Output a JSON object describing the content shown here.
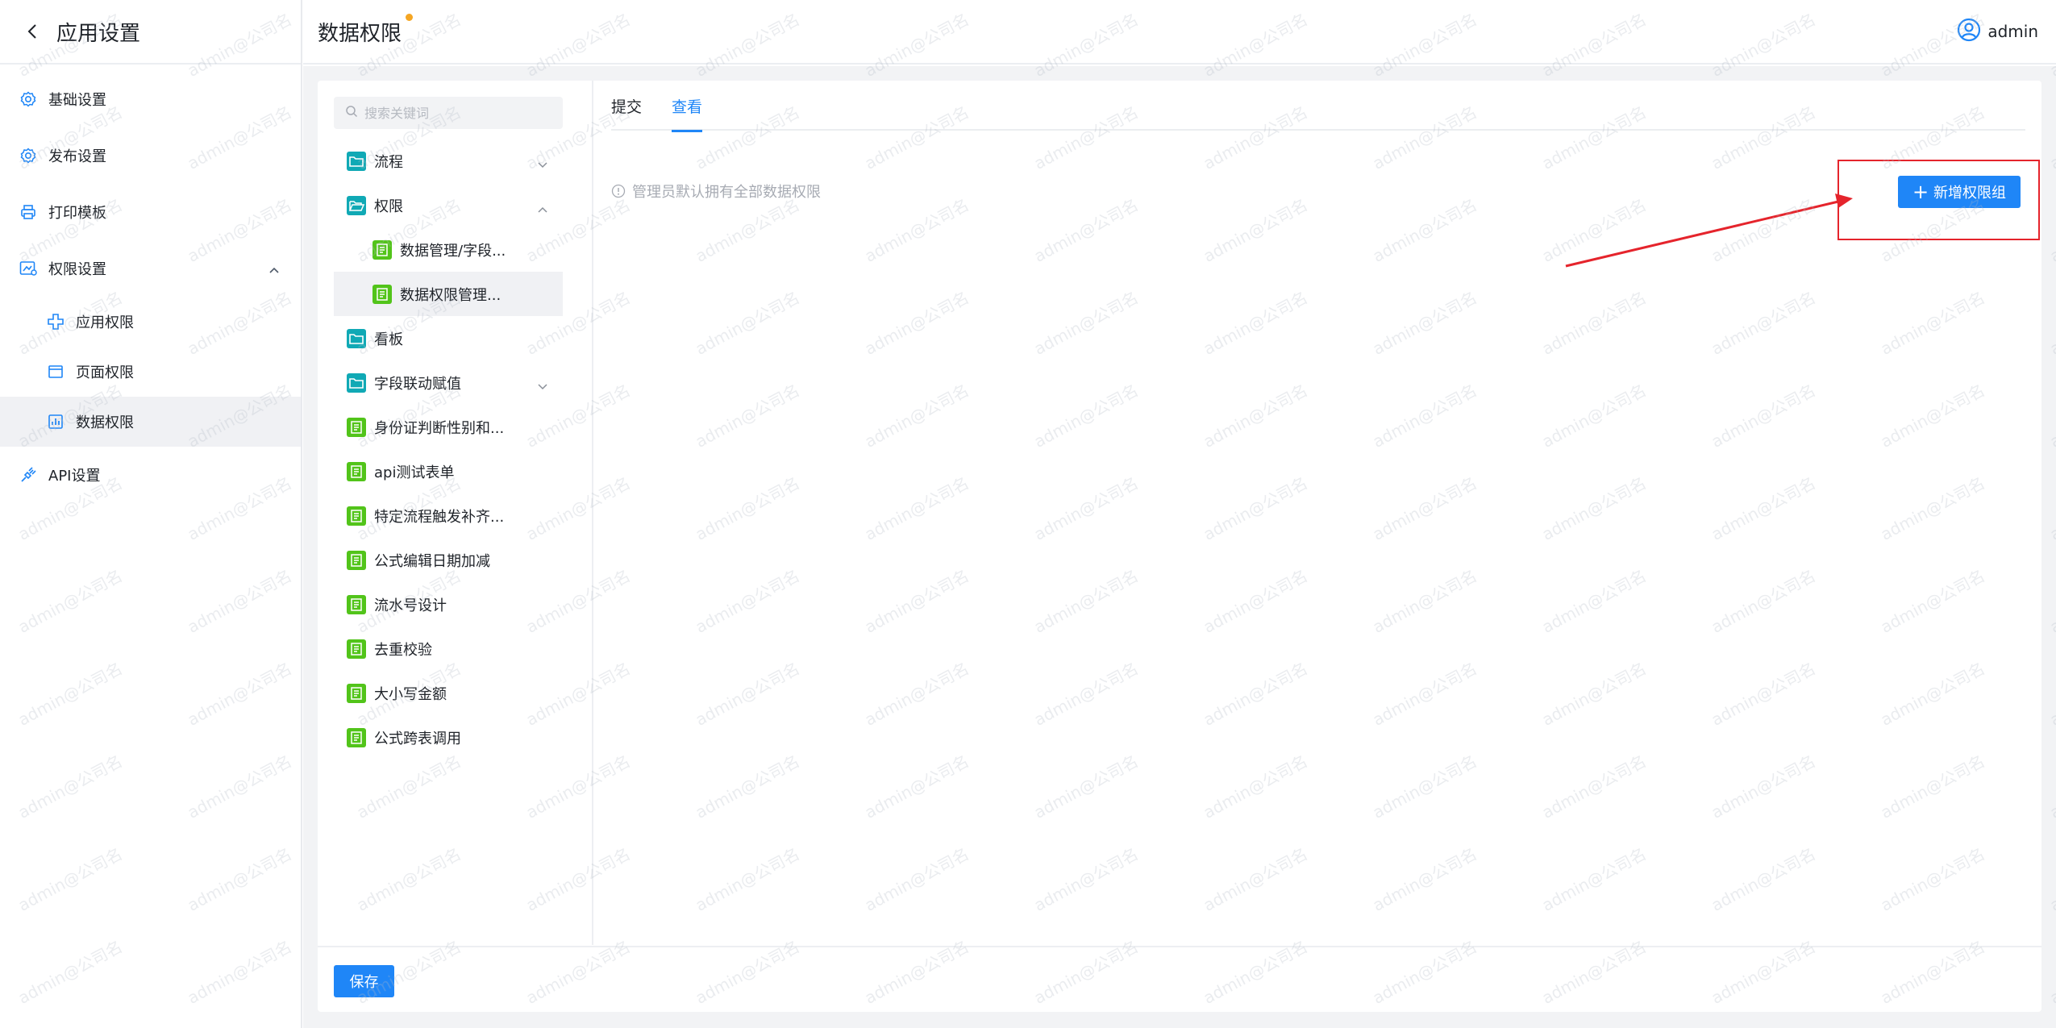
{
  "sidebar": {
    "title": "应用设置",
    "items": [
      {
        "label": "基础设置",
        "icon": "gear-icon"
      },
      {
        "label": "发布设置",
        "icon": "gear-icon"
      },
      {
        "label": "打印模板",
        "icon": "printer-icon"
      },
      {
        "label": "权限设置",
        "icon": "permission-icon",
        "expanded": true
      },
      {
        "label": "应用权限",
        "icon": "app-permission-icon"
      },
      {
        "label": "页面权限",
        "icon": "page-permission-icon"
      },
      {
        "label": "数据权限",
        "icon": "data-permission-icon",
        "active": true
      },
      {
        "label": "API设置",
        "icon": "api-icon"
      }
    ]
  },
  "header": {
    "title": "数据权限",
    "user": "admin"
  },
  "tree": {
    "search_placeholder": "搜索关键词",
    "nodes": [
      {
        "label": "流程",
        "type": "folder",
        "caret": "down"
      },
      {
        "label": "权限",
        "type": "folder-open",
        "caret": "up"
      },
      {
        "label": "数据管理/字段...",
        "type": "form",
        "child": true
      },
      {
        "label": "数据权限管理...",
        "type": "form",
        "child": true,
        "selected": true
      },
      {
        "label": "看板",
        "type": "folder"
      },
      {
        "label": "字段联动赋值",
        "type": "folder",
        "caret": "down"
      },
      {
        "label": "身份证判断性别和...",
        "type": "form"
      },
      {
        "label": "api测试表单",
        "type": "form"
      },
      {
        "label": "特定流程触发补齐...",
        "type": "form"
      },
      {
        "label": "公式编辑日期加减",
        "type": "form"
      },
      {
        "label": "流水号设计",
        "type": "form"
      },
      {
        "label": "去重校验",
        "type": "form"
      },
      {
        "label": "大小写金额",
        "type": "form"
      },
      {
        "label": "公式跨表调用",
        "type": "form"
      }
    ]
  },
  "main": {
    "tabs": [
      {
        "label": "提交"
      },
      {
        "label": "查看",
        "active": true
      }
    ],
    "tip": "管理员默认拥有全部数据权限",
    "add_button": "新增权限组"
  },
  "footer": {
    "save_label": "保存"
  },
  "watermark": "admin@公司名",
  "colors": {
    "primary": "#1f86f7",
    "folder": "#10a9b5",
    "form": "#52c41a",
    "annotation": "#e5242c",
    "dot": "#f5a623"
  }
}
